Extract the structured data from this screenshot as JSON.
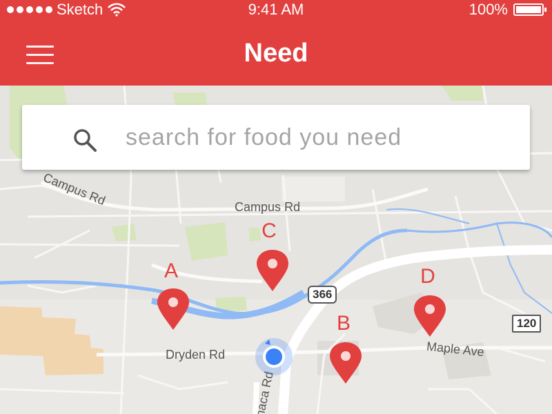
{
  "status_bar": {
    "carrier": "Sketch",
    "time": "9:41 AM",
    "battery": "100%"
  },
  "header": {
    "title": "Need",
    "menu_icon": "hamburger-menu-icon"
  },
  "search": {
    "placeholder": "search for food you need",
    "icon": "search-icon"
  },
  "map": {
    "road_labels": [
      "Campus Rd",
      "Campus Rd",
      "Dryden Rd",
      "Maple Ave",
      "Ithaca Rd"
    ],
    "route_shields": [
      "366",
      "120"
    ],
    "pins": [
      {
        "label": "A",
        "color": "#e2403f"
      },
      {
        "label": "B",
        "color": "#e2403f"
      },
      {
        "label": "C",
        "color": "#e2403f"
      },
      {
        "label": "D",
        "color": "#e2403f"
      }
    ],
    "current_location_color": "#3b82f6"
  },
  "colors": {
    "brand": "#e2403f",
    "map_background": "#e5e3df",
    "park": "#cfe3a8",
    "water": "#8ab4f8"
  }
}
